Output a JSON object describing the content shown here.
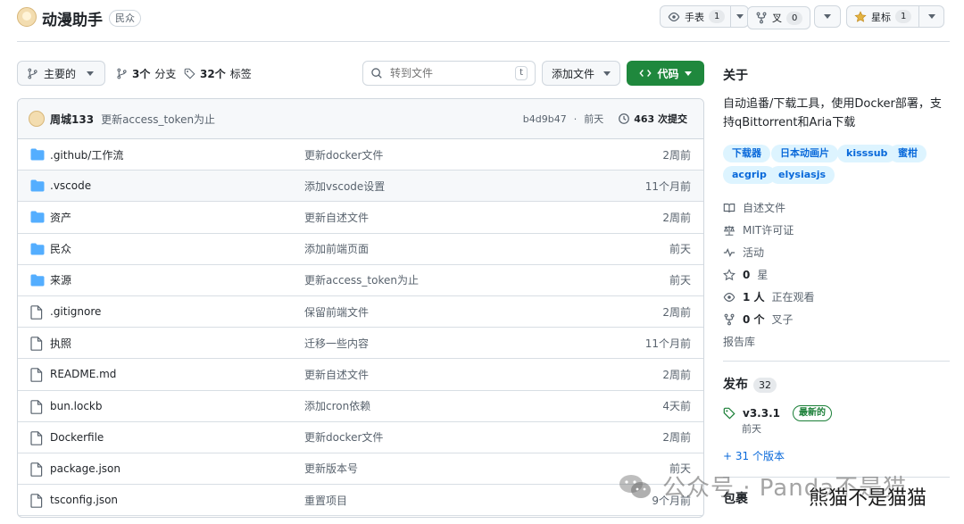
{
  "repo": {
    "name": "动漫助手",
    "visibility": "民众"
  },
  "header_buttons": {
    "watch": {
      "label": "手表",
      "count": "1"
    },
    "fork": {
      "label": "叉",
      "count": "0"
    },
    "star": {
      "label": "星标",
      "count": "1"
    }
  },
  "toolbar": {
    "branch": "主要的",
    "branches_count": "3个",
    "branches_label": "分支",
    "tags_count": "32个",
    "tags_label": "标签",
    "search_placeholder": "转到文件",
    "search_key": "t",
    "add_file": "添加文件",
    "code": "代码"
  },
  "commit": {
    "author": "周城133",
    "message": "更新access_token为止",
    "hash": "b4d9b47",
    "time": "前天",
    "count": "463 次提交"
  },
  "files": [
    {
      "type": "folder",
      "name": ".github/工作流",
      "message": "更新docker文件",
      "time": "2周前"
    },
    {
      "type": "folder",
      "name": ".vscode",
      "message": "添加vscode设置",
      "time": "11个月前"
    },
    {
      "type": "folder",
      "name": "资产",
      "message": "更新自述文件",
      "time": "2周前"
    },
    {
      "type": "folder",
      "name": "民众",
      "message": "添加前端页面",
      "time": "前天"
    },
    {
      "type": "folder",
      "name": "来源",
      "message": "更新access_token为止",
      "time": "前天"
    },
    {
      "type": "file",
      "name": ".gitignore",
      "message": "保留前端文件",
      "time": "2周前"
    },
    {
      "type": "file",
      "name": "执照",
      "message": "迁移一些内容",
      "time": "11个月前"
    },
    {
      "type": "file",
      "name": "README.md",
      "message": "更新自述文件",
      "time": "2周前"
    },
    {
      "type": "file",
      "name": "bun.lockb",
      "message": "添加cron依赖",
      "time": "4天前"
    },
    {
      "type": "file",
      "name": "Dockerfile",
      "message": "更新docker文件",
      "time": "2周前"
    },
    {
      "type": "file",
      "name": "package.json",
      "message": "更新版本号",
      "time": "前天"
    },
    {
      "type": "file",
      "name": "tsconfig.json",
      "message": "重置项目",
      "time": "9个月前"
    }
  ],
  "about": {
    "heading": "关于",
    "description": "自动追番/下载工具，使用Docker部署，支持qBittorrent和Aria下载",
    "topics": [
      "下载器",
      "日本动画片",
      "kisssub",
      "蜜柑",
      "acgrip",
      "elysiasjs"
    ],
    "links": {
      "readme": "自述文件",
      "license": "MIT许可证",
      "activity": "活动",
      "stars_count": "0",
      "stars_label": "星",
      "watching_count": "1 人",
      "watching_label": "正在观看",
      "forks_count": "0 个",
      "forks_label": "叉子",
      "report": "报告库"
    }
  },
  "releases": {
    "heading": "发布",
    "count": "32",
    "latest_tag": "v3.3.1",
    "latest_badge": "最新的",
    "latest_time": "前天",
    "more": "+ 31 个版本"
  },
  "packages": {
    "heading": "包裹"
  },
  "watermark": {
    "text": "公众号 · Panda不是猫",
    "sub": "熊猫不是猫猫"
  },
  "colors": {
    "accent": "#1f883d",
    "link": "#0969da",
    "folder": "#54aeff",
    "topic_bg": "#ddf4ff"
  }
}
